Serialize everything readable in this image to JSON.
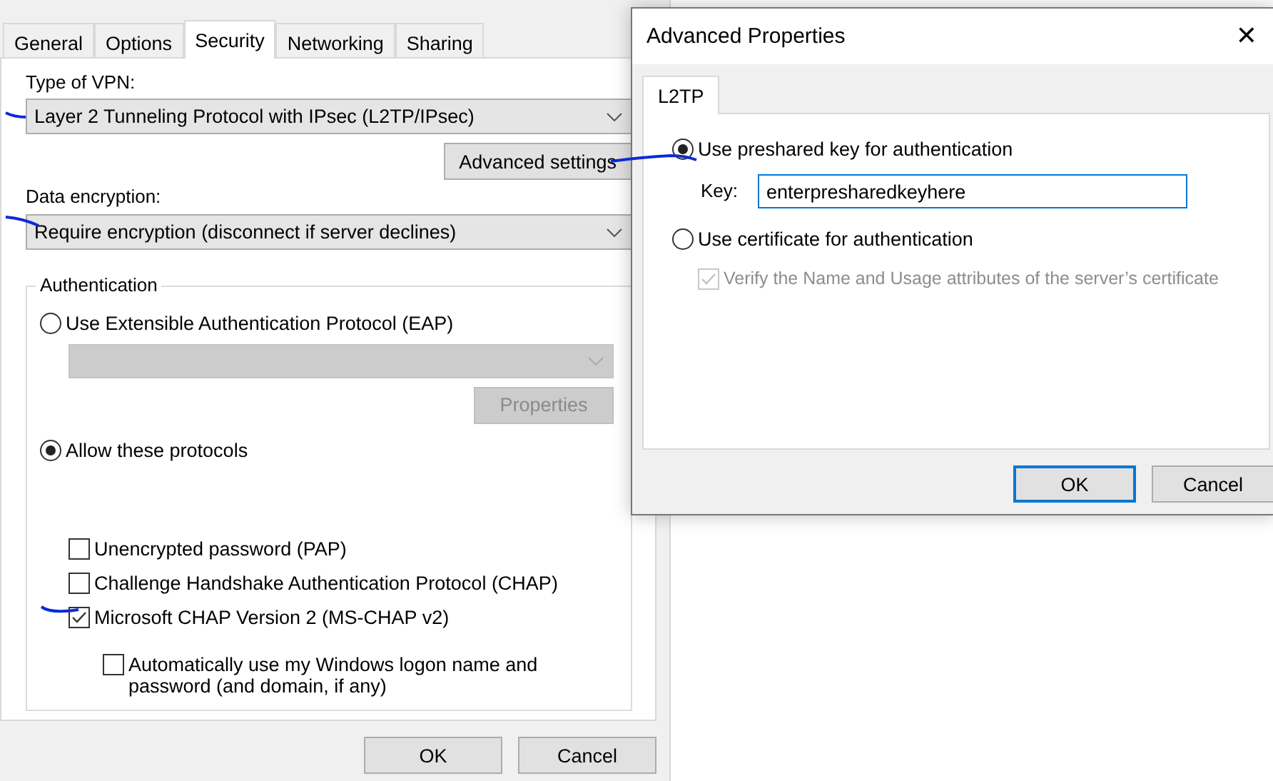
{
  "main_window": {
    "tabs": [
      {
        "label": "General",
        "selected": false
      },
      {
        "label": "Options",
        "selected": false
      },
      {
        "label": "Security",
        "selected": true
      },
      {
        "label": "Networking",
        "selected": false
      },
      {
        "label": "Sharing",
        "selected": false
      }
    ],
    "vpn_type": {
      "label": "Type of VPN:",
      "value": "Layer 2 Tunneling Protocol with IPsec (L2TP/IPsec)"
    },
    "advanced_button": "Advanced settings",
    "data_encryption": {
      "label": "Data encryption:",
      "value": "Require encryption (disconnect if server declines)"
    },
    "authentication": {
      "title": "Authentication",
      "options": [
        {
          "label": "Use Extensible Authentication Protocol (EAP)",
          "selected": false
        },
        {
          "label": "Allow these protocols",
          "selected": true
        }
      ],
      "eap_dropdown": {
        "disabled": true
      },
      "properties_button": {
        "label": "Properties",
        "disabled": true
      },
      "protocols": [
        {
          "label": "Unencrypted password (PAP)",
          "checked": false
        },
        {
          "label": "Challenge Handshake Authentication Protocol (CHAP)",
          "checked": false
        },
        {
          "label": "Microsoft CHAP Version 2 (MS-CHAP v2)",
          "checked": true,
          "children": [
            {
              "label": "Automatically use my Windows logon name and password (and domain, if any)",
              "checked": false
            }
          ]
        }
      ]
    },
    "buttons": [
      {
        "label": "OK",
        "default": false
      },
      {
        "label": "Cancel",
        "default": false
      }
    ]
  },
  "dialog": {
    "title": "Advanced Properties",
    "close": "✕",
    "tabs": [
      {
        "label": "L2TP",
        "selected": true
      }
    ],
    "options": [
      {
        "label": "Use preshared key for authentication",
        "selected": true
      },
      {
        "label": "Use certificate for authentication",
        "selected": false
      }
    ],
    "key": {
      "label": "Key:",
      "value": "enterpresharedkeyhere"
    },
    "verify": {
      "label": "Verify the Name and Usage attributes of the server’s certificate",
      "checked": true,
      "disabled": true
    },
    "buttons": [
      {
        "label": "OK",
        "default": true
      },
      {
        "label": "Cancel",
        "default": false
      }
    ]
  }
}
